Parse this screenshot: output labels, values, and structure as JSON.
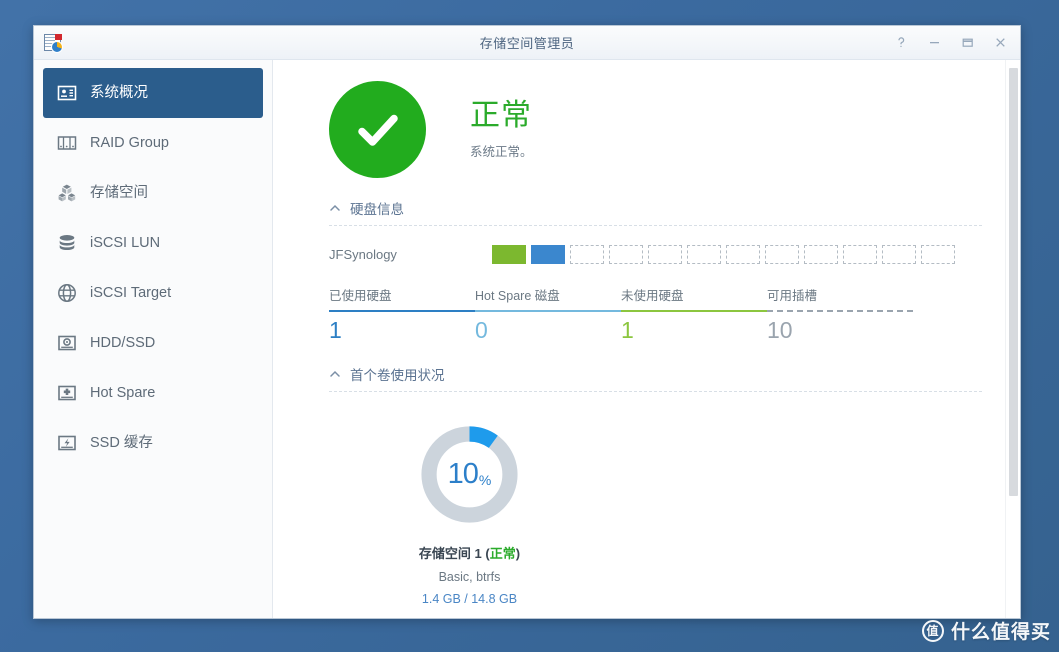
{
  "window": {
    "title": "存储空间管理员",
    "app_icon": "storage-manager-icon",
    "controls": {
      "help": "?",
      "minimize": "−",
      "maximize": "□",
      "close": "×"
    }
  },
  "sidebar": {
    "items": [
      {
        "label": "系统概况",
        "icon": "overview-icon",
        "active": true
      },
      {
        "label": "RAID Group",
        "icon": "raid-group-icon",
        "active": false
      },
      {
        "label": "存储空间",
        "icon": "volume-icon",
        "active": false
      },
      {
        "label": "iSCSI LUN",
        "icon": "database-icon",
        "active": false
      },
      {
        "label": "iSCSI Target",
        "icon": "globe-icon",
        "active": false
      },
      {
        "label": "HDD/SSD",
        "icon": "hdd-icon",
        "active": false
      },
      {
        "label": "Hot Spare",
        "icon": "hot-spare-icon",
        "active": false
      },
      {
        "label": "SSD 缓存",
        "icon": "ssd-cache-icon",
        "active": false
      }
    ]
  },
  "hero": {
    "icon": "checkmark-icon",
    "title": "正常",
    "subtitle": "系统正常。",
    "color": "#22ac1e"
  },
  "disk_info": {
    "section_title": "硬盘信息",
    "chevron": "chevron-up-icon",
    "enclosure_name": "JFSynology",
    "slots": [
      "unused",
      "used",
      "empty",
      "empty",
      "empty",
      "empty",
      "empty",
      "empty",
      "empty",
      "empty",
      "empty",
      "empty"
    ],
    "stats": [
      {
        "label": "已使用硬盘",
        "value": "1",
        "color": "#2d7fc4"
      },
      {
        "label": "Hot Spare 磁盘",
        "value": "0",
        "color": "#74b9de"
      },
      {
        "label": "未使用硬盘",
        "value": "1",
        "color": "#8cc63f"
      },
      {
        "label": "可用插槽",
        "value": "10",
        "color": "#9aa4ae"
      }
    ]
  },
  "volume_usage": {
    "section_title": "首个卷使用状况",
    "chevron": "chevron-up-icon",
    "percent": "10",
    "percent_unit": "%",
    "percent_value": 10,
    "arc_color": "#1e9bec",
    "track_color": "#ccd4dc",
    "name": "存储空间 1 (",
    "state": "正常",
    "name_suffix": ")",
    "type": "Basic, btrfs",
    "size": "1.4 GB / 14.8 GB"
  },
  "watermark": {
    "badge": "值",
    "text": "什么值得买"
  }
}
